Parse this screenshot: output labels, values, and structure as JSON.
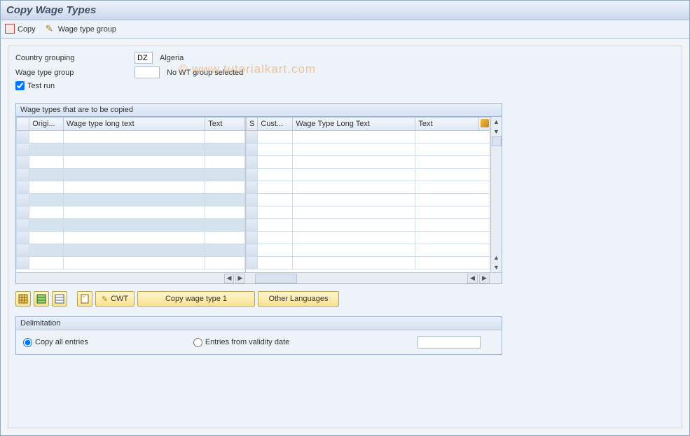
{
  "title": "Copy Wage Types",
  "toolbar": {
    "copy_label": "Copy",
    "wage_group_label": "Wage type group"
  },
  "watermark": "© www.tutorialkart.com",
  "form": {
    "country_grouping_label": "Country grouping",
    "country_grouping_value": "DZ",
    "country_grouping_text": "Algeria",
    "wage_type_group_label": "Wage type group",
    "wage_type_group_value": "",
    "wage_type_group_text": "No WT group selected",
    "test_run_label": "Test run",
    "test_run_checked": true
  },
  "table": {
    "title": "Wage types that are to be copied",
    "left_headers": [
      "Origi...",
      "Wage type long text",
      "Text"
    ],
    "right_headers": [
      "S",
      "Cust...",
      "Wage Type Long Text",
      "Text"
    ],
    "row_count": 11
  },
  "buttons": {
    "cwt": "CWT",
    "copy_wage_type": "Copy wage type 1",
    "other_languages": "Other Languages"
  },
  "delimitation": {
    "title": "Delimitation",
    "copy_all": "Copy all entries",
    "entries_from": "Entries from validity date",
    "date_value": ""
  }
}
